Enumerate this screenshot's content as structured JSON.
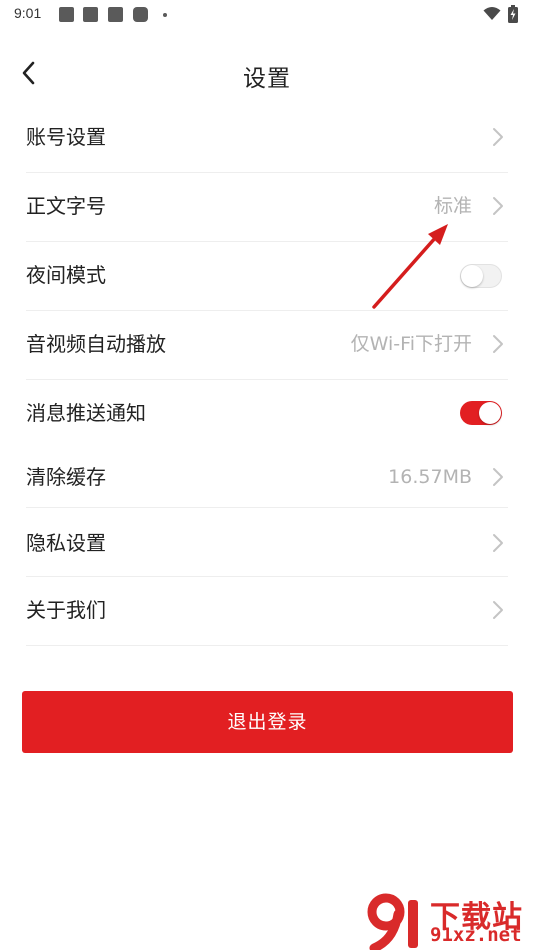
{
  "status_bar": {
    "time": "9:01",
    "icons": [
      "notification-icon",
      "notification-icon",
      "notification-icon",
      "notification-icon",
      "wifi-icon",
      "battery-icon"
    ]
  },
  "header": {
    "title": "设置",
    "back_icon": "chevron-left-icon"
  },
  "settings": {
    "items": [
      {
        "label": "账号设置",
        "value": "",
        "control": "chevron"
      },
      {
        "label": "正文字号",
        "value": "标准",
        "control": "chevron"
      },
      {
        "label": "夜间模式",
        "value": "",
        "control": "toggle",
        "on": false
      },
      {
        "label": "音视频自动播放",
        "value": "仅Wi-Fi下打开",
        "control": "chevron"
      },
      {
        "label": "消息推送通知",
        "value": "",
        "control": "toggle",
        "on": true
      },
      {
        "label": "清除缓存",
        "value": "16.57MB",
        "control": "chevron"
      },
      {
        "label": "隐私设置",
        "value": "",
        "control": "chevron"
      },
      {
        "label": "关于我们",
        "value": "",
        "control": "chevron"
      }
    ]
  },
  "logout": {
    "label": "退出登录"
  },
  "watermark": {
    "top": "下载站",
    "bottom": "91xz.net"
  },
  "colors": {
    "accent": "#e21f22",
    "text": "#222222",
    "secondary_text": "#b3b3b3",
    "divider": "#eeeeee",
    "annotation": "#d51d1d"
  }
}
